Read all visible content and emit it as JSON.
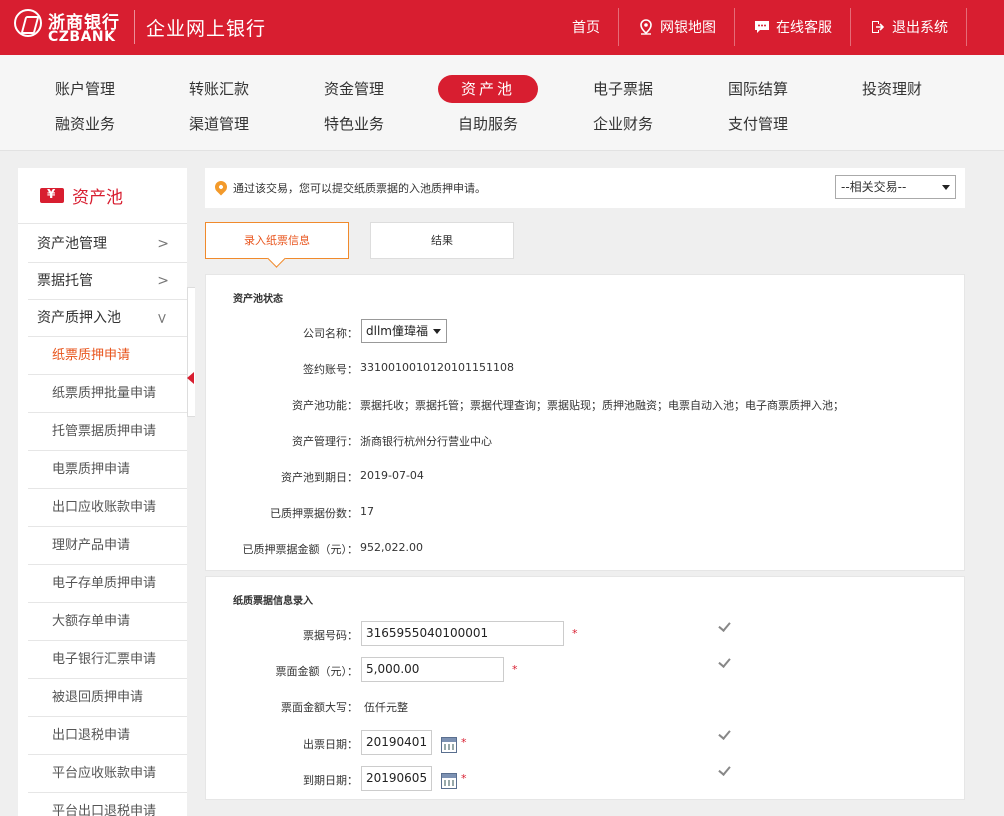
{
  "header": {
    "logo_cn": "浙商银行",
    "logo_en": "CZBANK",
    "system_title": "企业网上银行",
    "links": {
      "home": "首页",
      "map": "网银地图",
      "service": "在线客服",
      "logout": "退出系统"
    }
  },
  "nav": {
    "row1": [
      "账户管理",
      "转账汇款",
      "资金管理",
      "资产池",
      "电子票据",
      "国际结算",
      "投资理财"
    ],
    "row2": [
      "融资业务",
      "渠道管理",
      "特色业务",
      "自助服务",
      "企业财务",
      "支付管理"
    ],
    "active": "资产池"
  },
  "sidebar": {
    "title": "资产池",
    "groups": [
      "资产池管理",
      "票据托管",
      "资产质押入池"
    ],
    "sub_items": [
      "纸票质押申请",
      "纸票质押批量申请",
      "托管票据质押申请",
      "电票质押申请",
      "出口应收账款申请",
      "理财产品申请",
      "电子存单质押申请",
      "大额存单申请",
      "电子银行汇票申请",
      "被退回质押申请",
      "出口退税申请",
      "平台应收账款申请",
      "平台出口退税申请"
    ]
  },
  "notice": {
    "text": "通过该交易，您可以提交纸质票据的入池质押申请。",
    "related_select": "--相关交易--"
  },
  "tabs": {
    "step1": "录入纸票信息",
    "step2": "结果"
  },
  "status_panel": {
    "title": "资产池状态",
    "company_label": "公司名称：",
    "company_value": "dllm僮瑋福",
    "account_label": "签约账号：",
    "account_value": "331001001012010115110​8",
    "functions_label": "资产池功能：",
    "functions_value": "票据托收；票据托管；票据代理查询；票据贴现；质押池融资；电票自动入池；电子商票质押入池；",
    "bank_label": "资产管理行：",
    "bank_value": "浙商银行杭州分行营业中心",
    "expiry_label": "资产池到期日：",
    "expiry_value": "2019-07-04",
    "count_label": "已质押票据份数：",
    "count_value": "17",
    "amount_label": "已质押票据金额（元）：",
    "amount_value": "952,022.00"
  },
  "entry_panel": {
    "title": "纸质票据信息录入",
    "bill_no_label": "票据号码：",
    "bill_no_value": "3165955040100001",
    "amount_label": "票面金额（元）：",
    "amount_value": "5,000.00",
    "amount_cn_label": "票面金额大写：",
    "amount_cn_value": "伍仟元整",
    "issue_label": "出票日期：",
    "issue_value": "20190401",
    "due_label": "到期日期：",
    "due_value": "20190605",
    "required_mark": "*"
  }
}
